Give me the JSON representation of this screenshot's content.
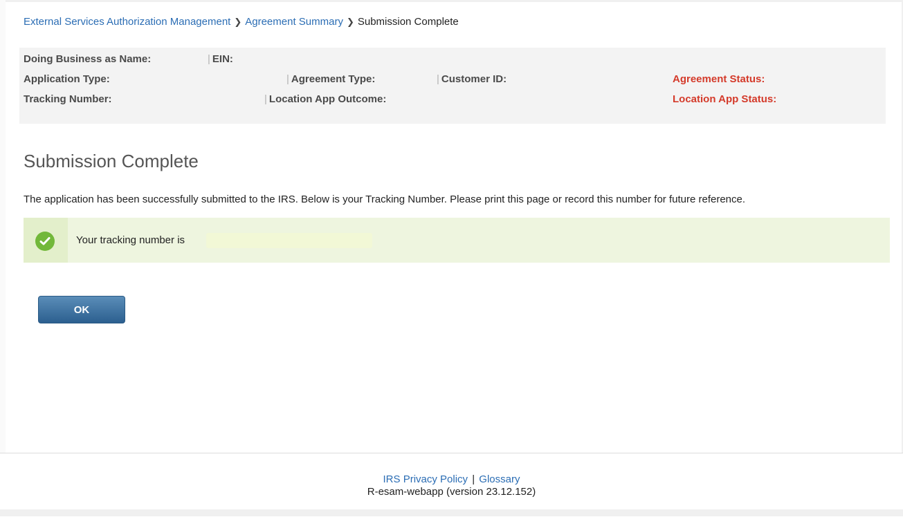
{
  "breadcrumb": {
    "item1": "External Services Authorization Management",
    "item2": "Agreement Summary",
    "current": "Submission Complete",
    "separator": "❯"
  },
  "summary": {
    "dba_label": "Doing Business as Name:",
    "ein_label": "EIN:",
    "application_type_label": "Application Type:",
    "agreement_type_label": "Agreement Type:",
    "customer_id_label": "Customer ID:",
    "agreement_status_label": "Agreement Status:",
    "tracking_number_label": "Tracking Number:",
    "location_app_outcome_label": "Location App Outcome:",
    "location_app_status_label": "Location App Status:",
    "pipe": "|"
  },
  "main": {
    "title": "Submission Complete",
    "description": "The application has been successfully submitted to the IRS. Below is your Tracking Number. Please print this page or record this number for future reference."
  },
  "alert": {
    "message": "Your tracking number is",
    "icon": "check-circle-icon"
  },
  "buttons": {
    "ok": "OK"
  },
  "footer": {
    "privacy_link": "IRS Privacy Policy",
    "separator": "|",
    "glossary_link": "Glossary",
    "version": "R-esam-webapp (version 23.12.152)"
  },
  "colors": {
    "link": "#2b6db4",
    "status_label": "#d43a2a",
    "success_bg": "#eef5df",
    "success_icon": "#72b83a",
    "button": "#3a6c9a"
  }
}
